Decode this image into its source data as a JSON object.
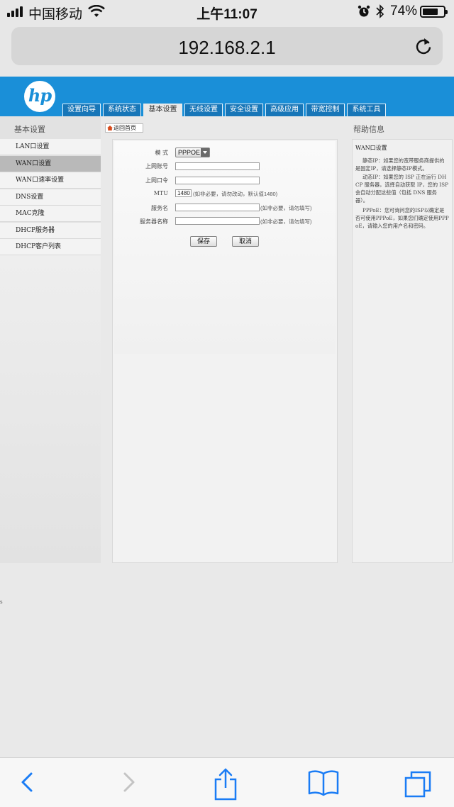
{
  "status_bar": {
    "carrier": "中国移动",
    "time": "上午11:07",
    "battery_percent": "74%",
    "battery_level": 0.74,
    "icons": [
      "signal-icon",
      "wifi-icon",
      "alarm-icon",
      "bluetooth-icon",
      "battery-icon"
    ]
  },
  "browser": {
    "url": "192.168.2.1",
    "reload_icon": "reload-icon",
    "toolbar_icons": [
      "back-icon",
      "forward-icon",
      "share-icon",
      "bookmarks-icon",
      "tabs-icon"
    ]
  },
  "router": {
    "logo": "hp",
    "nav_tabs": [
      {
        "label": "设置向导"
      },
      {
        "label": "系统状态"
      },
      {
        "label": "基本设置",
        "active": true
      },
      {
        "label": "无线设置"
      },
      {
        "label": "安全设置"
      },
      {
        "label": "高级应用"
      },
      {
        "label": "带宽控制"
      },
      {
        "label": "系统工具"
      }
    ],
    "sidebar": {
      "title": "基本设置",
      "items": [
        {
          "label": "LAN口设置"
        },
        {
          "label": "WAN口设置",
          "selected": true
        },
        {
          "label": "WAN口速率设置"
        },
        {
          "label": "DNS设置"
        },
        {
          "label": "MAC克隆"
        },
        {
          "label": "DHCP服务器"
        },
        {
          "label": "DHCP客户列表"
        }
      ]
    },
    "back_home": "返回首页",
    "form": {
      "mode_label": "模  式",
      "mode_value": "PPPOE",
      "account_label": "上网账号",
      "account_value": "",
      "password_label": "上网口令",
      "password_value": "",
      "mtu_label": "MTU",
      "mtu_value": "1480",
      "mtu_hint": "(如非必要，请勿改动，默认值1480)",
      "service_name_label": "服务名",
      "service_name_value": "",
      "service_name_hint": "(如非必要，请勿填写)",
      "server_name_label": "服务器名称",
      "server_name_value": "",
      "server_name_hint": "(如非必要，请勿填写)",
      "save_label": "保存",
      "cancel_label": "取消"
    },
    "help": {
      "title": "帮助信息",
      "heading": "WAN口设置",
      "p1": "静态IP：如果您的宽带服务商提供的是固定IP，请选择静态IP模式。",
      "p2": "动态IP：如果您的 ISP 正在运行 DHCP 服务器，选择自动获取 IP，您的 ISP 会自动分配这些值（包括 DNS 服务器）。",
      "p3": "PPPoE：您可询问您的ISP以确定是否可使用PPPoE，如果您们确定使用PPPoE，请输入您的用户名和密码。"
    },
    "stray_char": "s"
  }
}
